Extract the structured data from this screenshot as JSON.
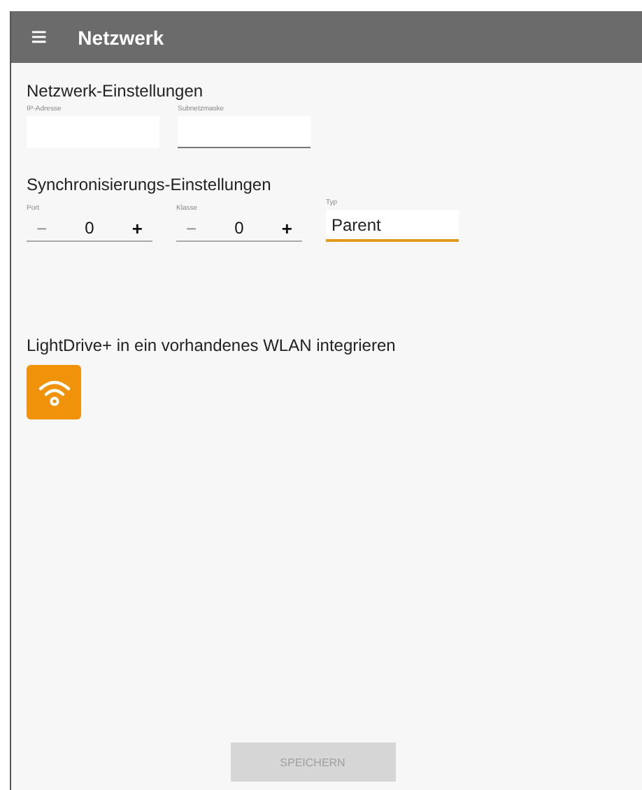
{
  "app_bar": {
    "menu_icon": "≡",
    "title": "Netzwerk"
  },
  "network_settings": {
    "heading": "Netzwerk-Einstellungen",
    "fields": [
      {
        "label": "IP-Adresse",
        "kind": "plain"
      },
      {
        "label": "Subnetzmaske",
        "kind": "underlined"
      }
    ]
  },
  "sync_settings": {
    "heading": "Synchronisierungs-Einstellungen",
    "steppers": [
      {
        "label": "Port",
        "minus": "−",
        "value": "0",
        "plus": "+",
        "minus_disabled": true
      },
      {
        "label": "Klasse",
        "minus": "−",
        "value": "0",
        "plus": "+",
        "minus_disabled": true
      }
    ],
    "type_field": {
      "label": "Typ",
      "value": "Parent",
      "focused": true
    }
  },
  "wlan": {
    "heading": "LightDrive+ in ein vorhandenes WLAN integrieren"
  },
  "save_button": {
    "label": "SPEICHERN",
    "disabled": true
  }
}
